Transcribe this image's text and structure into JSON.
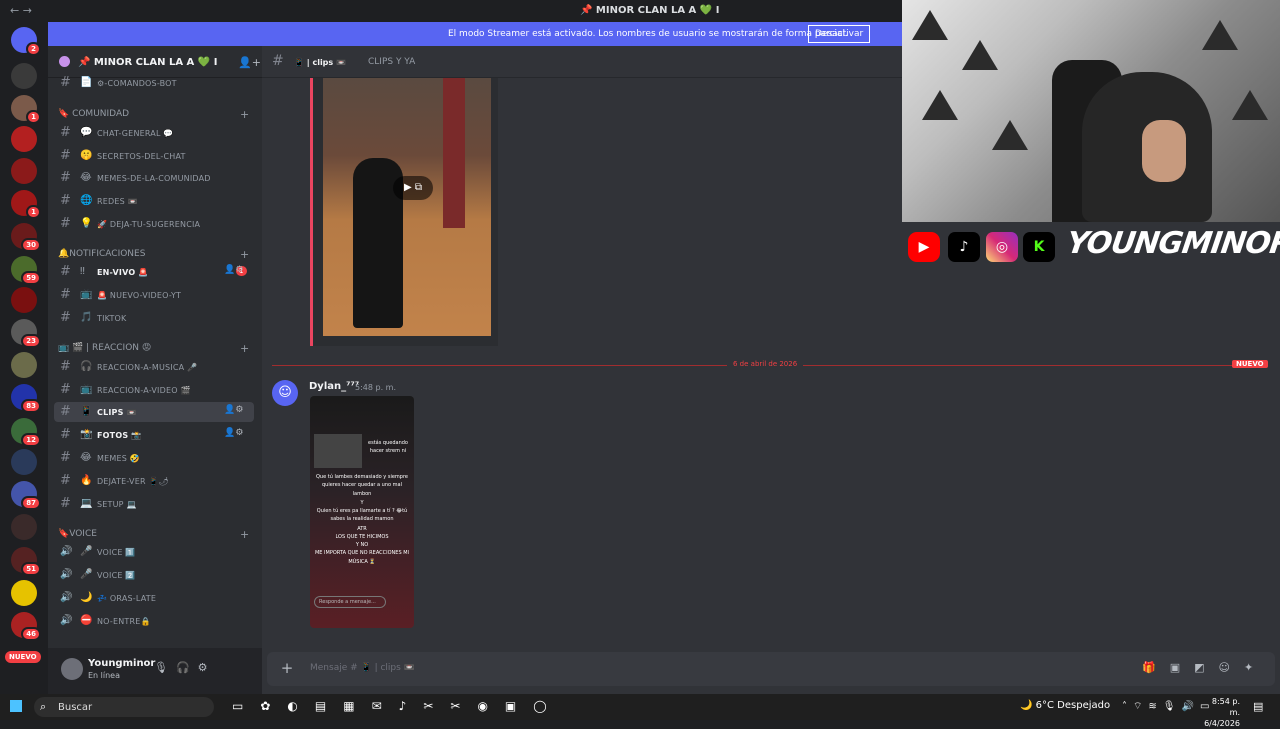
{
  "window": {
    "title": "📌 MINOR CLAN LA A 💚 I",
    "nav": "←  →"
  },
  "banner": {
    "text": "El modo Streamer está activado. Los nombres de usuario se mostrarán de forma parcial.",
    "button": "Desactivar"
  },
  "servers": {
    "new_label": "NUEVO",
    "items": [
      {
        "badge": "2",
        "color": "#5865f2"
      },
      {
        "badge": "",
        "color": "#3a3a3a"
      },
      {
        "badge": "1",
        "color": "#7b5a4a"
      },
      {
        "badge": "",
        "color": "#b32020"
      },
      {
        "badge": "",
        "color": "#8b1a1a"
      },
      {
        "badge": "1",
        "color": "#a01818"
      },
      {
        "badge": "30",
        "color": "#6a1b1b"
      },
      {
        "badge": "59",
        "color": "#4b6b2b"
      },
      {
        "badge": "",
        "color": "#7a1010"
      },
      {
        "badge": "23",
        "color": "#5a5a5a"
      },
      {
        "badge": "",
        "color": "#6b6b4a"
      },
      {
        "badge": "83",
        "color": "#2233aa"
      },
      {
        "badge": "12",
        "color": "#3a6b3a"
      },
      {
        "badge": "",
        "color": "#2a3a5a"
      },
      {
        "badge": "87",
        "color": "#4455aa"
      },
      {
        "badge": "",
        "color": "#3a2a2a"
      },
      {
        "badge": "51",
        "color": "#552222"
      },
      {
        "badge": "",
        "color": "#e6c200"
      },
      {
        "badge": "46",
        "color": "#aa2222"
      }
    ]
  },
  "sidebar": {
    "server_name": "📌 MINOR CLAN LA A 💚 I",
    "rows": [
      {
        "type": "ch",
        "emoji": "📄",
        "name": "⚙-comandos-bot"
      },
      {
        "type": "cat",
        "name": "🔖 COMUNIDAD"
      },
      {
        "type": "ch",
        "emoji": "💬",
        "name": "chat-general 💬"
      },
      {
        "type": "ch",
        "emoji": "🤫",
        "name": "secretos-del-chat"
      },
      {
        "type": "ch",
        "emoji": "😂",
        "name": "memes-de-la-comunidad"
      },
      {
        "type": "ch",
        "emoji": "🌐",
        "name": "redes 📼"
      },
      {
        "type": "ch",
        "emoji": "💡",
        "name": "🚀 deja-tu-sugerencia"
      },
      {
        "type": "cat",
        "name": "🔔NOTIFICACIONES"
      },
      {
        "type": "ch",
        "emoji": "‼",
        "name": "en-vivo 🚨",
        "unread": true,
        "badge": "1"
      },
      {
        "type": "ch",
        "emoji": "📺",
        "name": "🚨 nuevo-video-yt"
      },
      {
        "type": "ch",
        "emoji": "🎵",
        "name": "tiktok"
      },
      {
        "type": "cat",
        "name": "📺 🎬 | REACCION 😡"
      },
      {
        "type": "ch",
        "emoji": "🎧",
        "name": "reaccion-a-musica 🎤"
      },
      {
        "type": "ch",
        "emoji": "📺",
        "name": "reaccion-a-video 🎬"
      },
      {
        "type": "ch",
        "emoji": "📱",
        "name": "clips 📼",
        "selected": true
      },
      {
        "type": "ch",
        "emoji": "📸",
        "name": "fotos 📸",
        "unread": true
      },
      {
        "type": "ch",
        "emoji": "😂",
        "name": "memes 🤣"
      },
      {
        "type": "ch",
        "emoji": "🔥",
        "name": "dejate-ver 📱🌶"
      },
      {
        "type": "ch",
        "emoji": "💻",
        "name": "setup 💻"
      },
      {
        "type": "cat",
        "name": "🔖VOICE"
      },
      {
        "type": "voice",
        "emoji": "🎤",
        "name": "voice 1️⃣"
      },
      {
        "type": "voice",
        "emoji": "🎤",
        "name": "voice 2️⃣"
      },
      {
        "type": "voice",
        "emoji": "🌙",
        "name": "💤 oras-late"
      },
      {
        "type": "voice",
        "emoji": "⛔",
        "name": "no-entre🔒"
      }
    ]
  },
  "user": {
    "name": "Youngminor",
    "status": "En línea"
  },
  "chat": {
    "channel": "📱 | clips 📼",
    "topic": "CLIPS Y YA",
    "date_divider": "6 de abril de 2026",
    "new_label": "NUEVO",
    "message": {
      "author": "Dylan_⁷⁷⁷",
      "time": "5:48 p. m."
    },
    "phone_text": [
      "estás quedando",
      "hacer strem ni",
      "Que tú lambes demasiado y siempre",
      "quieres hacer quedar a uno mal",
      "lambon",
      "Y",
      "Quien tú eres pa llamarte a tí ? 😂tú",
      "sabes la realidad mamon",
      "ATR",
      "LOS QUE TE HICIMOS",
      "Y NO",
      "ME IMPORTA QUE NO REACCIONES MI",
      "MÚSICA ⏳"
    ],
    "phone_reply": "Responde a mensaje...",
    "composer_placeholder": "Mensaje # 📱 | clips 📼"
  },
  "stream": {
    "brand": "YOUNGMINOR",
    "icons": [
      "youtube-icon",
      "tiktok-icon",
      "instagram-icon",
      "kick-icon"
    ]
  },
  "taskbar": {
    "search": "Buscar",
    "weather": "6°C  Despejado",
    "time": "8:54 p. m.",
    "date": "6/4/2026"
  }
}
